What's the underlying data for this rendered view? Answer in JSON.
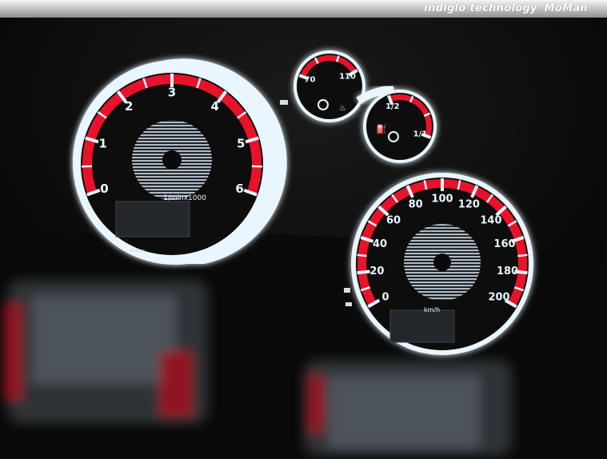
{
  "banner": {
    "tagline": "indiglo technology",
    "brand": "MoMan"
  },
  "tachometer": {
    "ticks": [
      "0",
      "1",
      "2",
      "3",
      "4",
      "5",
      "6"
    ],
    "unit": "1/minx1000",
    "maker": "MoMan"
  },
  "temperature_gauge": {
    "ticks": [
      "70",
      "110"
    ]
  },
  "fuel_gauge": {
    "ticks": [
      "1/2",
      "1/1"
    ]
  },
  "speedometer": {
    "ticks": [
      "0",
      "20",
      "40",
      "60",
      "80",
      "100",
      "120",
      "140",
      "160",
      "180",
      "200"
    ],
    "unit": "km/h"
  },
  "colors": {
    "background": "#020202",
    "dial_face": "#0d0d0d",
    "backlight": "#e9f6ff",
    "redline": "#e8132a",
    "glow": "#cfe9ff"
  }
}
